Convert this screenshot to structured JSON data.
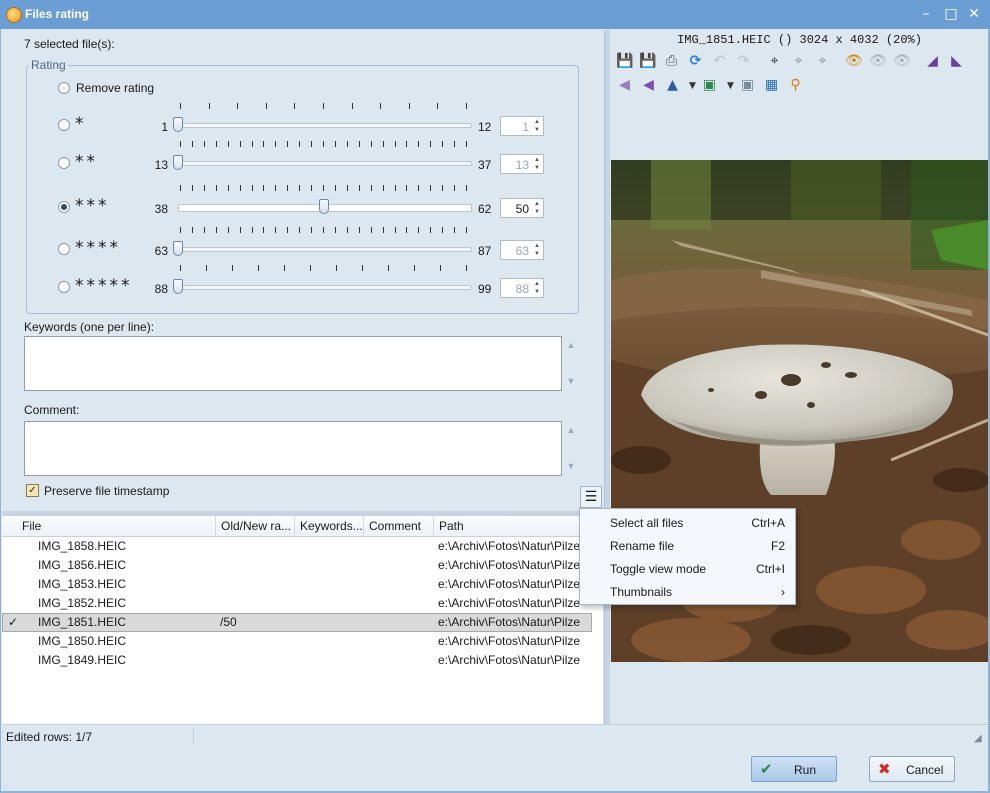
{
  "window": {
    "title": "Files rating"
  },
  "selection_summary": "7 selected file(s):",
  "rating": {
    "group_label": "Rating",
    "remove_label": "Remove rating",
    "rows": [
      {
        "stars": "*",
        "min": "1",
        "max": "12",
        "value": "1",
        "position": 0.0,
        "checked": false
      },
      {
        "stars": "**",
        "min": "13",
        "max": "37",
        "value": "13",
        "position": 0.0,
        "checked": false
      },
      {
        "stars": "***",
        "min": "38",
        "max": "62",
        "value": "50",
        "position": 0.5,
        "checked": true
      },
      {
        "stars": "****",
        "min": "63",
        "max": "87",
        "value": "63",
        "position": 0.0,
        "checked": false
      },
      {
        "stars": "*****",
        "min": "88",
        "max": "99",
        "value": "88",
        "position": 0.0,
        "checked": false
      }
    ]
  },
  "keywords_label": "Keywords (one per line):",
  "comment_label": "Comment:",
  "preserve_timestamp_label": "Preserve file timestamp",
  "file_list": {
    "columns": [
      "File",
      "Old/New ra...",
      "Keywords...",
      "Comment",
      "Path"
    ],
    "rows": [
      {
        "check": "",
        "file": "IMG_1858.HEIC",
        "rating": "",
        "path": "e:\\Archiv\\Fotos\\Natur\\Pilze"
      },
      {
        "check": "",
        "file": "IMG_1856.HEIC",
        "rating": "",
        "path": "e:\\Archiv\\Fotos\\Natur\\Pilze"
      },
      {
        "check": "",
        "file": "IMG_1853.HEIC",
        "rating": "",
        "path": "e:\\Archiv\\Fotos\\Natur\\Pilze"
      },
      {
        "check": "",
        "file": "IMG_1852.HEIC",
        "rating": "",
        "path": "e:\\Archiv\\Fotos\\Natur\\Pilze"
      },
      {
        "check": "✓",
        "file": "IMG_1851.HEIC",
        "rating": "/50",
        "path": "e:\\Archiv\\Fotos\\Natur\\Pilze"
      },
      {
        "check": "",
        "file": "IMG_1850.HEIC",
        "rating": "",
        "path": "e:\\Archiv\\Fotos\\Natur\\Pilze"
      },
      {
        "check": "",
        "file": "IMG_1849.HEIC",
        "rating": "",
        "path": "e:\\Archiv\\Fotos\\Natur\\Pilze"
      }
    ]
  },
  "status": {
    "edited_rows": "Edited rows: 1/7"
  },
  "preview": {
    "caption": "IMG_1851.HEIC ()  3024 x 4032 (20%)"
  },
  "context_menu": {
    "items": [
      {
        "label": "Select all files",
        "shortcut": "Ctrl+A"
      },
      {
        "label": "Rename file",
        "shortcut": "F2"
      },
      {
        "label": "Toggle view mode",
        "shortcut": "Ctrl+I"
      },
      {
        "label": "Thumbnails",
        "shortcut": "›"
      }
    ]
  },
  "buttons": {
    "run": "Run",
    "cancel": "Cancel"
  },
  "colors": {
    "titlebar": "#6a9ed4",
    "accent": "#2a7fd4",
    "background": "#dde7f0"
  }
}
